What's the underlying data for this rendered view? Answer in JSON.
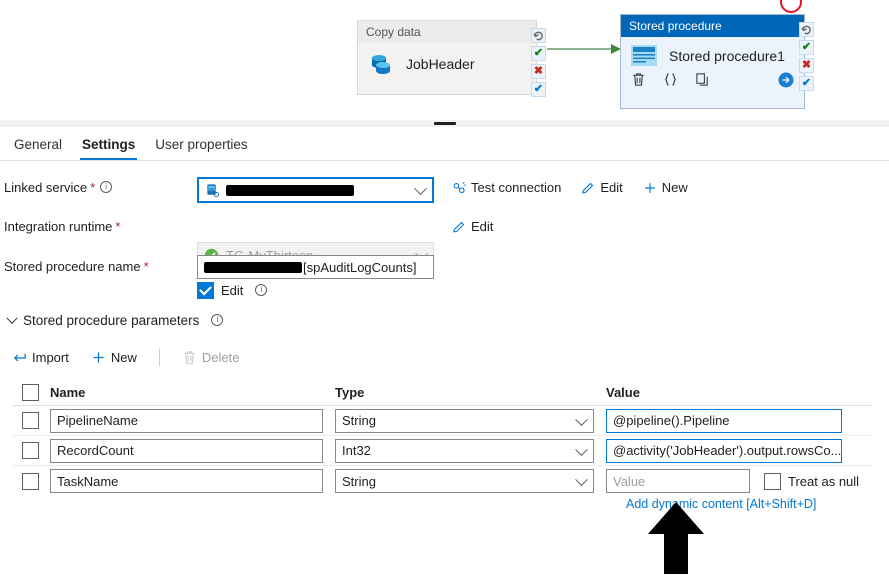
{
  "canvas": {
    "activities": [
      {
        "type_label": "Copy data",
        "name": "JobHeader",
        "icon": "copy-data-database-icon",
        "selected": false
      },
      {
        "type_label": "Stored procedure",
        "name": "Stored procedure1",
        "icon": "stored-procedure-icon",
        "selected": true,
        "actions": [
          {
            "icon": "delete-trash-icon",
            "glyph": "trash"
          },
          {
            "icon": "code-braces-icon",
            "glyph": "braces"
          },
          {
            "icon": "clone-copy-icon",
            "glyph": "clone"
          },
          {
            "icon": "run-arrow-icon",
            "glyph": "arrow"
          }
        ]
      }
    ],
    "dependencies": [
      {
        "name": "retry-dependency-icon",
        "glyph": "↻"
      },
      {
        "name": "success-dependency-icon",
        "glyph": "✔"
      },
      {
        "name": "failure-dependency-icon",
        "glyph": "✖"
      },
      {
        "name": "completion-dependency-icon",
        "glyph": "✔"
      }
    ],
    "annotation_circle": "red-circle-annotation"
  },
  "tabs": [
    {
      "label": "General",
      "active": false
    },
    {
      "label": "Settings",
      "active": true
    },
    {
      "label": "User properties",
      "active": false
    }
  ],
  "settings": {
    "linked_service": {
      "label": "Linked service",
      "required": "*",
      "value": "",
      "redacted": true,
      "icon": "sql-database-icon",
      "actions": [
        {
          "label": "Test connection",
          "icon": "test-connection-icon"
        },
        {
          "label": "Edit",
          "icon": "pencil-edit-icon"
        },
        {
          "label": "New",
          "icon": "plus-new-icon"
        }
      ]
    },
    "integration_runtime": {
      "label": "Integration runtime",
      "required": "*",
      "value": "TG-MyThirteen",
      "status_icon": "green-check-circle-icon",
      "edit_label": "Edit",
      "edit_icon": "pencil-edit-icon"
    },
    "stored_procedure_name": {
      "label": "Stored procedure name",
      "required": "*",
      "value": "[spAuditLogCounts]",
      "redacted_prefix": true,
      "edit_checkbox_label": "Edit",
      "edit_checked": true
    },
    "parameters_section": {
      "label": "Stored procedure parameters",
      "expanded": true
    },
    "toolbar": [
      {
        "label": "Import",
        "icon": "import-arrow-icon",
        "disabled": false
      },
      {
        "label": "New",
        "icon": "plus-new-icon",
        "disabled": false
      },
      {
        "label": "Delete",
        "icon": "delete-trash-icon",
        "disabled": true
      }
    ],
    "table": {
      "columns": [
        "Name",
        "Type",
        "Value"
      ],
      "rows": [
        {
          "checked": false,
          "name": "PipelineName",
          "type": "String",
          "value": "@pipeline().Pipeline",
          "value_placeholder": "Value",
          "value_is_dynamic": true,
          "treat_as_null": null
        },
        {
          "checked": false,
          "name": "RecordCount",
          "type": "Int32",
          "value": "@activity('JobHeader').output.rowsCo...",
          "value_placeholder": "Value",
          "value_is_dynamic": true,
          "treat_as_null": null
        },
        {
          "checked": false,
          "name": "TaskName",
          "type": "String",
          "value": "",
          "value_placeholder": "Value",
          "value_is_dynamic": false,
          "treat_as_null": {
            "label": "Treat as null",
            "checked": false
          }
        }
      ]
    },
    "dynamic_content_link": "Add dynamic content [Alt+Shift+D]"
  },
  "colors": {
    "accent": "#0078d4",
    "title_bar": "#0067b8",
    "success": "#107c10",
    "failure": "#c42b1c",
    "annotation": "#e81123",
    "required": "#a4262c"
  }
}
